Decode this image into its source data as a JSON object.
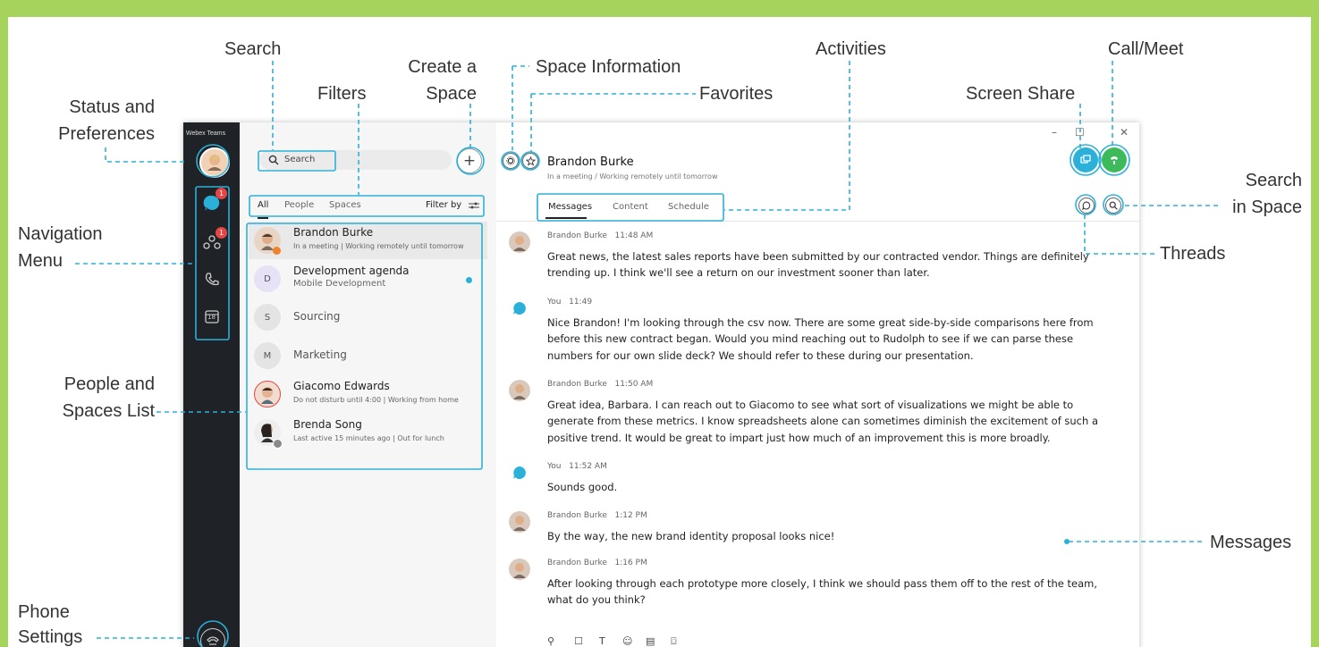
{
  "colors": {
    "background": "#a6d35c",
    "accent": "#2bb1d9",
    "call": "#3dba5b",
    "badge": "#e64545",
    "nav": "#1f2226"
  },
  "annotations": {
    "search": "Search",
    "create_space_1": "Create a",
    "create_space_2": "Space",
    "space_information": "Space Information",
    "filters": "Filters",
    "favorites": "Favorites",
    "activities": "Activities",
    "screen_share": "Screen Share",
    "call_meet": "Call/Meet",
    "status_1": "Status and",
    "status_2": "Preferences",
    "search_in_space_1": "Search",
    "search_in_space_2": "in Space",
    "navigation_1": "Navigation",
    "navigation_2": "Menu",
    "threads": "Threads",
    "people_spaces_1": "People and",
    "people_spaces_2": "Spaces List",
    "messages": "Messages",
    "phone_settings_1": "Phone",
    "phone_settings_2": "Settings"
  },
  "nav": {
    "brand": "Webex Teams",
    "badges": [
      "1",
      "1"
    ],
    "icons": [
      "status-avatar",
      "messaging-icon",
      "teams-icon",
      "phone-icon",
      "calendar-icon",
      "phone-settings-icon"
    ],
    "calendar_day": "18"
  },
  "list": {
    "search_placeholder": "Search",
    "create_label": "+",
    "filters": {
      "all": "All",
      "people": "People",
      "spaces": "Spaces",
      "filter_by": "Filter by"
    },
    "items": [
      {
        "name": "Brandon Burke",
        "sub": "In a meeting  |  Working remotely until tomorrow",
        "initial": ""
      },
      {
        "name": "Development agenda",
        "sub": "Mobile Development",
        "initial": "D"
      },
      {
        "name": "Sourcing",
        "sub": "",
        "initial": "S"
      },
      {
        "name": "Marketing",
        "sub": "",
        "initial": "M"
      },
      {
        "name": "Giacomo Edwards",
        "sub": "Do not disturb until 4:00  |  Working from home",
        "initial": ""
      },
      {
        "name": "Brenda Song",
        "sub": "Last active 15 minutes ago  |  Out for lunch",
        "initial": ""
      }
    ]
  },
  "space": {
    "title": "Brandon Burke",
    "subtitle": "In a meeting  /  Working remotely until tomorrow",
    "tabs": [
      "Messages",
      "Content",
      "Schedule"
    ],
    "window_controls": [
      "–",
      "☐",
      "✕"
    ]
  },
  "messages": [
    {
      "author": "Brandon Burke",
      "time": "11:48 AM",
      "text": "Great news, the latest sales reports have been submitted by our contracted vendor. Things are definitely trending up. I think we'll see a return on our investment sooner than later.",
      "self": false
    },
    {
      "author": "You",
      "time": "11:49",
      "text": "Nice Brandon! I'm looking through the csv now. There are some great side-by-side comparisons here from before this new contract began. Would you mind reaching out to Rudolph to see if we can parse these numbers for our own slide deck? We should refer to these during our presentation.",
      "self": true
    },
    {
      "author": "Brandon Burke",
      "time": "11:50 AM",
      "text": "Great idea, Barbara. I can reach out to Giacomo to see what sort of visualizations we might be able to generate from these metrics. I know spreadsheets alone can sometimes diminish the excitement of such a positive trend. It would be great to impart just how much of an improvement this is more broadly.",
      "self": false
    },
    {
      "author": "You",
      "time": "11:52 AM",
      "text": "Sounds good.",
      "self": true
    },
    {
      "author": "Brandon Burke",
      "time": "1:12 PM",
      "text": "By the way, the new brand identity proposal looks nice!",
      "self": false
    },
    {
      "author": "Brandon Burke",
      "time": "1:16 PM",
      "text": "After looking through each prototype more closely, I think we should pass them off to the rest of the team, what do you think?",
      "self": false
    }
  ],
  "composer": {
    "icons": [
      "attach-icon",
      "whiteboard-icon",
      "format-icon",
      "emoji-icon",
      "gif-icon",
      "screenshot-icon"
    ]
  }
}
